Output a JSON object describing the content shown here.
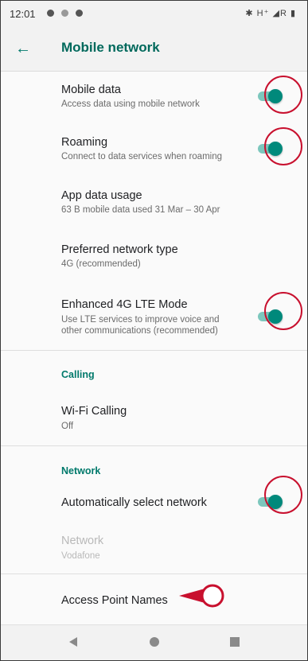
{
  "status_bar": {
    "time": "12:01",
    "right_icons": "✱ H⁺ ◢R ▮"
  },
  "toolbar": {
    "back_icon": "←",
    "title": "Mobile network"
  },
  "items": [
    {
      "title": "Mobile data",
      "summary": "Access data using mobile network",
      "toggle_on": true
    },
    {
      "title": "Roaming",
      "summary": "Connect to data services when roaming",
      "toggle_on": true
    },
    {
      "title": "App data usage",
      "summary": "63 B mobile data used 31 Mar – 30 Apr"
    },
    {
      "title": "Preferred network type",
      "summary": "4G (recommended)"
    },
    {
      "title": "Enhanced 4G LTE Mode",
      "summary_line1": "Use LTE services to improve voice and",
      "summary_line2": "other communications (recommended)",
      "toggle_on": true
    }
  ],
  "calling": {
    "header": "Calling",
    "wifi_calling": {
      "title": "Wi-Fi Calling",
      "summary": "Off"
    }
  },
  "network": {
    "header": "Network",
    "auto_select": {
      "title": "Automatically select network",
      "toggle_on": true
    },
    "network_item": {
      "title": "Network",
      "summary": "Vodafone",
      "disabled": true
    },
    "apn": {
      "title": "Access Point Names"
    }
  },
  "colors": {
    "accent": "#00796b",
    "toggle_thumb": "#00897b",
    "toggle_track": "#7cc7bd",
    "annotation": "#c8102e"
  },
  "icons": {
    "back": "arrow-left-icon",
    "nav_back": "triangle-back-icon",
    "nav_home": "circle-home-icon",
    "nav_recents": "square-recents-icon"
  }
}
